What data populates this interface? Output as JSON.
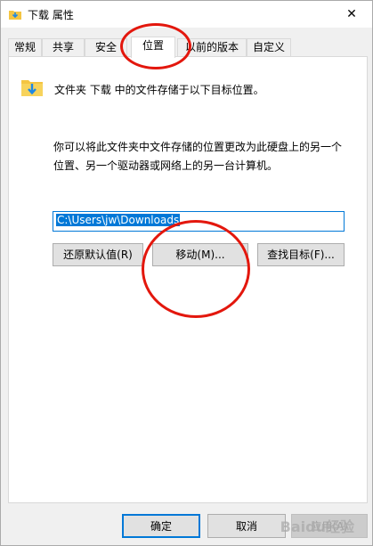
{
  "window": {
    "title": "下载 属性",
    "close_glyph": "✕"
  },
  "tabs": [
    {
      "label": "常规",
      "active": false
    },
    {
      "label": "共享",
      "active": false
    },
    {
      "label": "安全",
      "active": false
    },
    {
      "label": "位置",
      "active": true
    },
    {
      "label": "以前的版本",
      "active": false
    },
    {
      "label": "自定义",
      "active": false
    }
  ],
  "location": {
    "description": "文件夹 下载 中的文件存储于以下目标位置。",
    "info_line1": "你可以将此文件夹中文件存储的位置更改为此硬盘上的另一个",
    "info_line2": "位置、另一个驱动器或网络上的另一台计算机。",
    "path_value": "C:\\Users\\jw\\Downloads",
    "restore_default_label": "还原默认值(R)",
    "move_label": "移动(M)...",
    "find_target_label": "查找目标(F)..."
  },
  "footer": {
    "ok_label": "确定",
    "cancel_label": "取消",
    "apply_label": "应用(A)"
  },
  "watermark": "Baidu经验",
  "colors": {
    "accent": "#0078d7",
    "annotation": "#e3170d",
    "folder": "#f4c542",
    "arrow": "#1e88e5"
  },
  "icons": {
    "title": "download-folder-icon",
    "close": "close-icon",
    "folder": "download-folder-icon"
  }
}
